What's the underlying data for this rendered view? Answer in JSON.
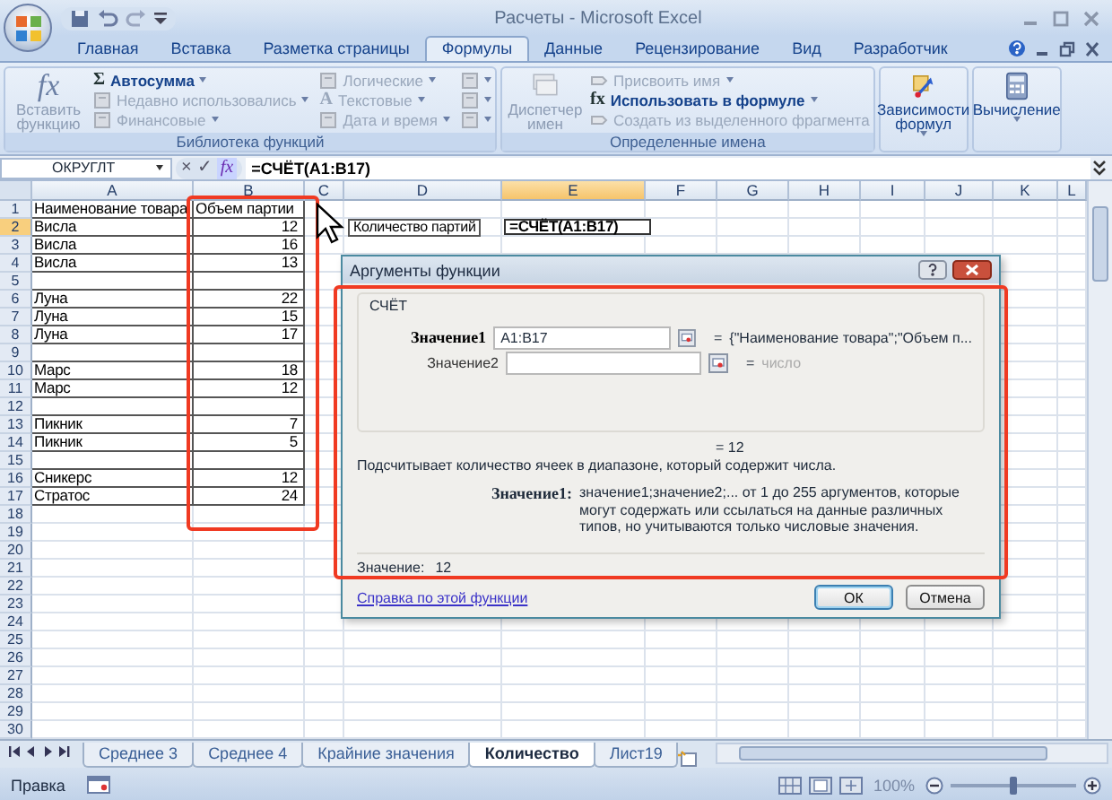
{
  "window": {
    "title": "Расчеты - Microsoft Excel"
  },
  "ribbon_tabs": [
    {
      "label": "Главная",
      "selected": false
    },
    {
      "label": "Вставка",
      "selected": false
    },
    {
      "label": "Разметка страницы",
      "selected": false
    },
    {
      "label": "Формулы",
      "selected": true
    },
    {
      "label": "Данные",
      "selected": false
    },
    {
      "label": "Рецензирование",
      "selected": false
    },
    {
      "label": "Вид",
      "selected": false
    },
    {
      "label": "Разработчик",
      "selected": false
    }
  ],
  "ribbon_groups": [
    {
      "title": "Библиотека функций",
      "items": [
        {
          "kind": "large",
          "label": "Вставить функцию",
          "glyph": "fx",
          "disabled": true
        },
        {
          "kind": "small",
          "label": "Автосумма",
          "glyph": "Σ",
          "disabled": false,
          "dropdown": true
        },
        {
          "kind": "small",
          "label": "Недавно использовались",
          "disabled": true,
          "dropdown": true
        },
        {
          "kind": "small",
          "label": "Финансовые",
          "disabled": true,
          "dropdown": true
        },
        {
          "kind": "small",
          "label": "Логические",
          "disabled": true,
          "dropdown": true
        },
        {
          "kind": "small",
          "label": "Текстовые",
          "glyph": "A",
          "disabled": true,
          "dropdown": true
        },
        {
          "kind": "small",
          "label": "Дата и время",
          "disabled": true,
          "dropdown": true
        },
        {
          "kind": "icon",
          "disabled": true,
          "dropdown": true
        },
        {
          "kind": "icon",
          "disabled": true,
          "dropdown": true
        },
        {
          "kind": "icon",
          "disabled": true,
          "dropdown": true
        }
      ]
    },
    {
      "title": "Определенные имена",
      "items": [
        {
          "kind": "large",
          "label": "Диспетчер имен",
          "disabled": true
        },
        {
          "kind": "small",
          "label": "Присвоить имя",
          "disabled": true,
          "dropdown": true
        },
        {
          "kind": "small",
          "label": "Использовать в формуле",
          "glyph": "fx",
          "disabled": false,
          "dropdown": true
        },
        {
          "kind": "small",
          "label": "Создать из выделенного фрагмента",
          "disabled": true
        }
      ]
    },
    {
      "items": [
        {
          "kind": "large",
          "label": "Зависимости формул",
          "disabled": false,
          "dropdown": true
        }
      ]
    },
    {
      "items": [
        {
          "kind": "large",
          "label": "Вычисление",
          "disabled": false,
          "dropdown": true
        }
      ]
    }
  ],
  "formula_bar": {
    "name_box": "ОКРУГЛТ",
    "cancel": "×",
    "enter": "✓",
    "insert": "fx",
    "formula": "=СЧЁТ(A1:B17)"
  },
  "sheet": {
    "columns": [
      {
        "label": "A",
        "selected": false
      },
      {
        "label": "B",
        "selected": false
      },
      {
        "label": "C",
        "selected": false
      },
      {
        "label": "D",
        "selected": false
      },
      {
        "label": "E",
        "selected": true
      },
      {
        "label": "F",
        "selected": false
      },
      {
        "label": "G",
        "selected": false
      },
      {
        "label": "H",
        "selected": false
      },
      {
        "label": "I",
        "selected": false
      },
      {
        "label": "J",
        "selected": false
      },
      {
        "label": "K",
        "selected": false
      },
      {
        "label": "L",
        "selected": false
      }
    ],
    "summary": {
      "label": "Количество партий",
      "formula": "=СЧЁТ(A1:B17)"
    },
    "rows": [
      {
        "number": "1",
        "selected": false,
        "bordered": true,
        "kind": "header",
        "name": "Наименование товара",
        "amount": "Объем партии"
      },
      {
        "number": "2",
        "selected": true,
        "bordered": true,
        "kind": "data",
        "name": "Висла",
        "amount": "12"
      },
      {
        "number": "3",
        "selected": false,
        "bordered": true,
        "kind": "data",
        "name": "Висла",
        "amount": "16"
      },
      {
        "number": "4",
        "selected": false,
        "bordered": true,
        "kind": "data",
        "name": "Висла",
        "amount": "13"
      },
      {
        "number": "5",
        "selected": false,
        "bordered": true,
        "kind": "data"
      },
      {
        "number": "6",
        "selected": false,
        "bordered": true,
        "kind": "data",
        "name": "Луна",
        "amount": "22"
      },
      {
        "number": "7",
        "selected": false,
        "bordered": true,
        "kind": "data",
        "name": "Луна",
        "amount": "15"
      },
      {
        "number": "8",
        "selected": false,
        "bordered": true,
        "kind": "data",
        "name": "Луна",
        "amount": "17"
      },
      {
        "number": "9",
        "selected": false,
        "bordered": true,
        "kind": "data"
      },
      {
        "number": "10",
        "selected": false,
        "bordered": true,
        "kind": "data",
        "name": "Марс",
        "amount": "18"
      },
      {
        "number": "11",
        "selected": false,
        "bordered": true,
        "kind": "data",
        "name": "Марс",
        "amount": "12"
      },
      {
        "number": "12",
        "selected": false,
        "bordered": true,
        "kind": "data"
      },
      {
        "number": "13",
        "selected": false,
        "bordered": true,
        "kind": "data",
        "name": "Пикник",
        "amount": "7"
      },
      {
        "number": "14",
        "selected": false,
        "bordered": true,
        "kind": "data",
        "name": "Пикник",
        "amount": "5"
      },
      {
        "number": "15",
        "selected": false,
        "bordered": true,
        "kind": "data"
      },
      {
        "number": "16",
        "selected": false,
        "bordered": true,
        "kind": "data",
        "name": "Сникерс",
        "amount": "12"
      },
      {
        "number": "17",
        "selected": false,
        "bordered": true,
        "kind": "data",
        "name": "Стратос",
        "amount": "24"
      },
      {
        "number": "18",
        "selected": false,
        "bordered": false,
        "kind": "data"
      },
      {
        "number": "19",
        "selected": false,
        "bordered": false,
        "kind": "data"
      },
      {
        "number": "20",
        "selected": false,
        "bordered": false,
        "kind": "data"
      },
      {
        "number": "21",
        "selected": false,
        "bordered": false,
        "kind": "data"
      },
      {
        "number": "22",
        "selected": false,
        "bordered": false,
        "kind": "data"
      },
      {
        "number": "23",
        "selected": false,
        "bordered": false,
        "kind": "data"
      },
      {
        "number": "24",
        "selected": false,
        "bordered": false,
        "kind": "data"
      },
      {
        "number": "25",
        "selected": false,
        "bordered": false,
        "kind": "data"
      },
      {
        "number": "26",
        "selected": false,
        "bordered": false,
        "kind": "data"
      },
      {
        "number": "27",
        "selected": false,
        "bordered": false,
        "kind": "data"
      },
      {
        "number": "28",
        "selected": false,
        "bordered": false,
        "kind": "data"
      },
      {
        "number": "29",
        "selected": false,
        "bordered": false,
        "kind": "data"
      },
      {
        "number": "30",
        "selected": false,
        "bordered": false,
        "kind": "data"
      }
    ]
  },
  "dialog": {
    "title": "Аргументы функции",
    "function": "СЧЁТ",
    "arguments": [
      {
        "label": "Значение1",
        "value": "A1:B17",
        "result": "{\"Наименование товара\";\"Объем п...",
        "active": true
      },
      {
        "label": "Значение2",
        "result": "число",
        "active": false
      }
    ],
    "equals": "=",
    "formula_result": "= 12",
    "description": "Подсчитывает количество ячеек в диапазоне, который содержит числа.",
    "help_label": "Значение1:",
    "help_text": "значение1;значение2;... от 1 до 255 аргументов, которые могут содержать или ссылаться на данные различных типов, но учитываются только числовые значения.",
    "value_label": "Значение:",
    "value": "12",
    "link": "Справка по этой функции",
    "buttons": [
      "ОК",
      "Отмена"
    ]
  },
  "sheet_tabs": [
    {
      "label": "Среднее 3",
      "selected": false
    },
    {
      "label": "Среднее 4",
      "selected": false
    },
    {
      "label": "Крайние значения",
      "selected": false
    },
    {
      "label": "Количество",
      "selected": true
    },
    {
      "label": "Лист19",
      "selected": false
    }
  ],
  "status_bar": {
    "mode": "Правка",
    "zoom": "100%",
    "level": 0.5
  }
}
